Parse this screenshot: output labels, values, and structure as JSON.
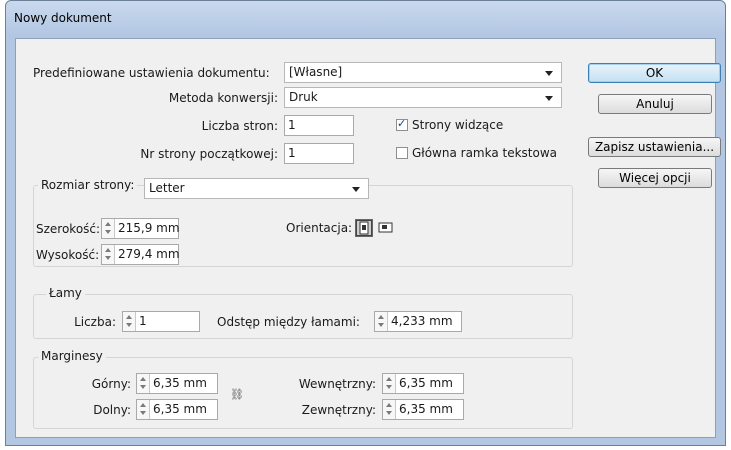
{
  "window": {
    "title": "Nowy dokument"
  },
  "preset": {
    "label": "Predefiniowane ustawienia dokumentu:",
    "value": "[Własne]"
  },
  "conversion": {
    "label": "Metoda konwersji:",
    "value": "Druk"
  },
  "pages": {
    "label": "Liczba stron:",
    "value": "1"
  },
  "start_page": {
    "label": "Nr strony początkowej:",
    "value": "1"
  },
  "facing_pages": {
    "label": "Strony widzące",
    "checked": true
  },
  "master_text_frame": {
    "label": "Główna ramka tekstowa",
    "checked": false
  },
  "page_size": {
    "label": "Rozmiar strony:",
    "value": "Letter",
    "width_label": "Szerokość:",
    "width_value": "215,9 mm",
    "height_label": "Wysokość:",
    "height_value": "279,4 mm",
    "orientation_label": "Orientacja:",
    "orientation": "portrait"
  },
  "columns": {
    "title": "Łamy",
    "count_label": "Liczba:",
    "count_value": "1",
    "gutter_label": "Odstęp między łamami:",
    "gutter_value": "4,233 mm"
  },
  "margins": {
    "title": "Marginesy",
    "top_label": "Górny:",
    "top_value": "6,35 mm",
    "bottom_label": "Dolny:",
    "bottom_value": "6,35 mm",
    "inside_label": "Wewnętrzny:",
    "inside_value": "6,35 mm",
    "outside_label": "Zewnętrzny:",
    "outside_value": "6,35 mm"
  },
  "buttons": {
    "ok": "OK",
    "cancel": "Anuluj",
    "save_preset": "Zapisz ustawienia...",
    "more_options": "Więcej opcji"
  },
  "icons": {
    "check": "✓",
    "link": "⛓"
  }
}
